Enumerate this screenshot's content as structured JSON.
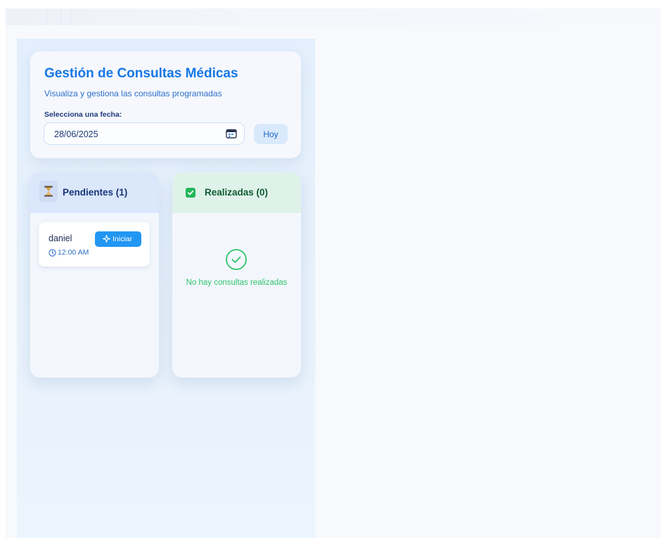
{
  "header": {
    "title": "Gestión de Consultas Médicas",
    "subtitle": "Visualiza y gestiona las consultas programadas",
    "date_label": "Selecciona una fecha:",
    "date_value": "28/06/2025",
    "today_button": "Hoy"
  },
  "pending": {
    "title": "Pendientes (1)",
    "icon": "hourglass-icon",
    "items": [
      {
        "patient": "daniel",
        "time": "12:00 AM",
        "action": "Iniciar"
      }
    ]
  },
  "done": {
    "title": "Realizadas (0)",
    "icon": "checkbox-icon",
    "empty_text": "No hay consultas realizadas"
  },
  "colors": {
    "primary": "#1677e6",
    "button": "#2196f3",
    "success": "#2fc46a",
    "pending_header": "#dbe7fb",
    "done_header": "#dff2ea"
  }
}
